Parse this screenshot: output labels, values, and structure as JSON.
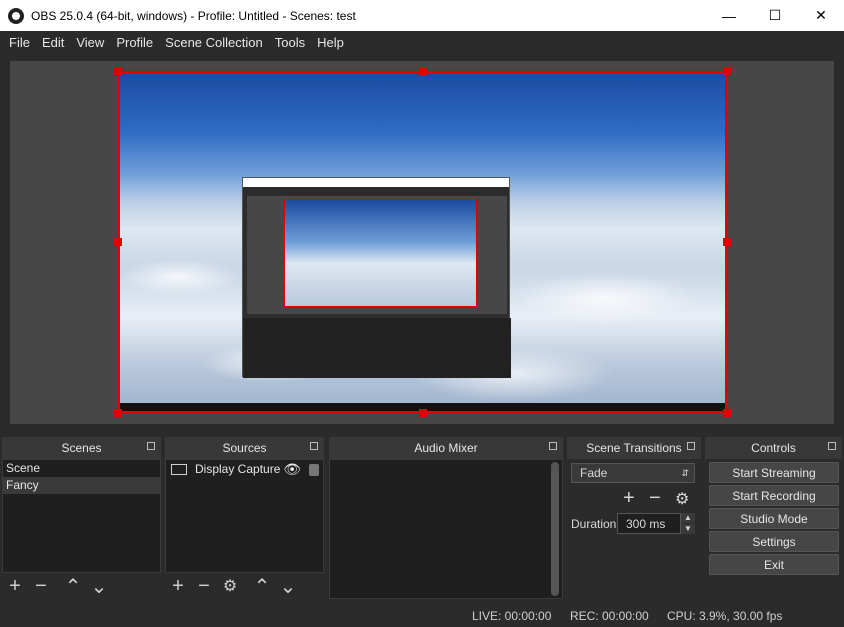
{
  "window": {
    "title": "OBS 25.0.4 (64-bit, windows) - Profile: Untitled - Scenes: test"
  },
  "menu": [
    "File",
    "Edit",
    "View",
    "Profile",
    "Scene Collection",
    "Tools",
    "Help"
  ],
  "scenes": {
    "title": "Scenes",
    "items": [
      "Scene",
      "Fancy"
    ],
    "selected": "Fancy"
  },
  "sources": {
    "title": "Sources",
    "items": [
      {
        "label": "Display Capture",
        "icon": "monitor-icon"
      }
    ]
  },
  "mixer": {
    "title": "Audio Mixer"
  },
  "transitions": {
    "title": "Scene Transitions",
    "selected": "Fade",
    "duration_label": "Duration",
    "duration_value": "300 ms"
  },
  "controls": {
    "title": "Controls",
    "buttons": [
      "Start Streaming",
      "Start Recording",
      "Studio Mode",
      "Settings",
      "Exit"
    ]
  },
  "status": {
    "live": "LIVE: 00:00:00",
    "rec": "REC: 00:00:00",
    "cpu": "CPU: 3.9%, 30.00 fps"
  },
  "colors": {
    "selection": "#e00000",
    "background": "#2b2b2b",
    "panel": "#1f1f1f"
  }
}
